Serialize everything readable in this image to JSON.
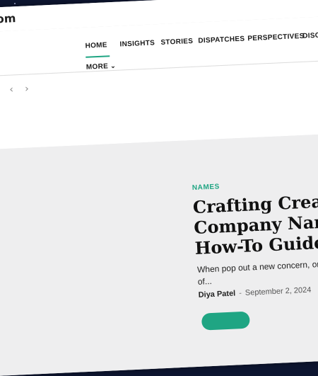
{
  "browser": {
    "domain": "om"
  },
  "nav": {
    "items": [
      {
        "label": "HOME"
      },
      {
        "label": "INSIGHTS"
      },
      {
        "label": "STORIES"
      },
      {
        "label": "DISPATCHES"
      },
      {
        "label": "PERSPECTIVES"
      },
      {
        "label": "DISCO"
      }
    ],
    "more_label": "MORE",
    "active_item": "HOME"
  },
  "carousel": {
    "prev_glyph": "‹",
    "next_glyph": "›"
  },
  "article": {
    "category": "NAMES",
    "headline_lines": [
      "Crafting Creat",
      "Company Nam",
      "How-To Guide"
    ],
    "excerpt_line1": "When pop out a new concern, one of t",
    "excerpt_line2": "of...",
    "author": "Diya Patel",
    "separator": "-",
    "date": "September 2, 2024"
  },
  "colors": {
    "accent": "#1fa583",
    "page_background": "#eeeeef",
    "desktop_background": "#0d1530"
  }
}
